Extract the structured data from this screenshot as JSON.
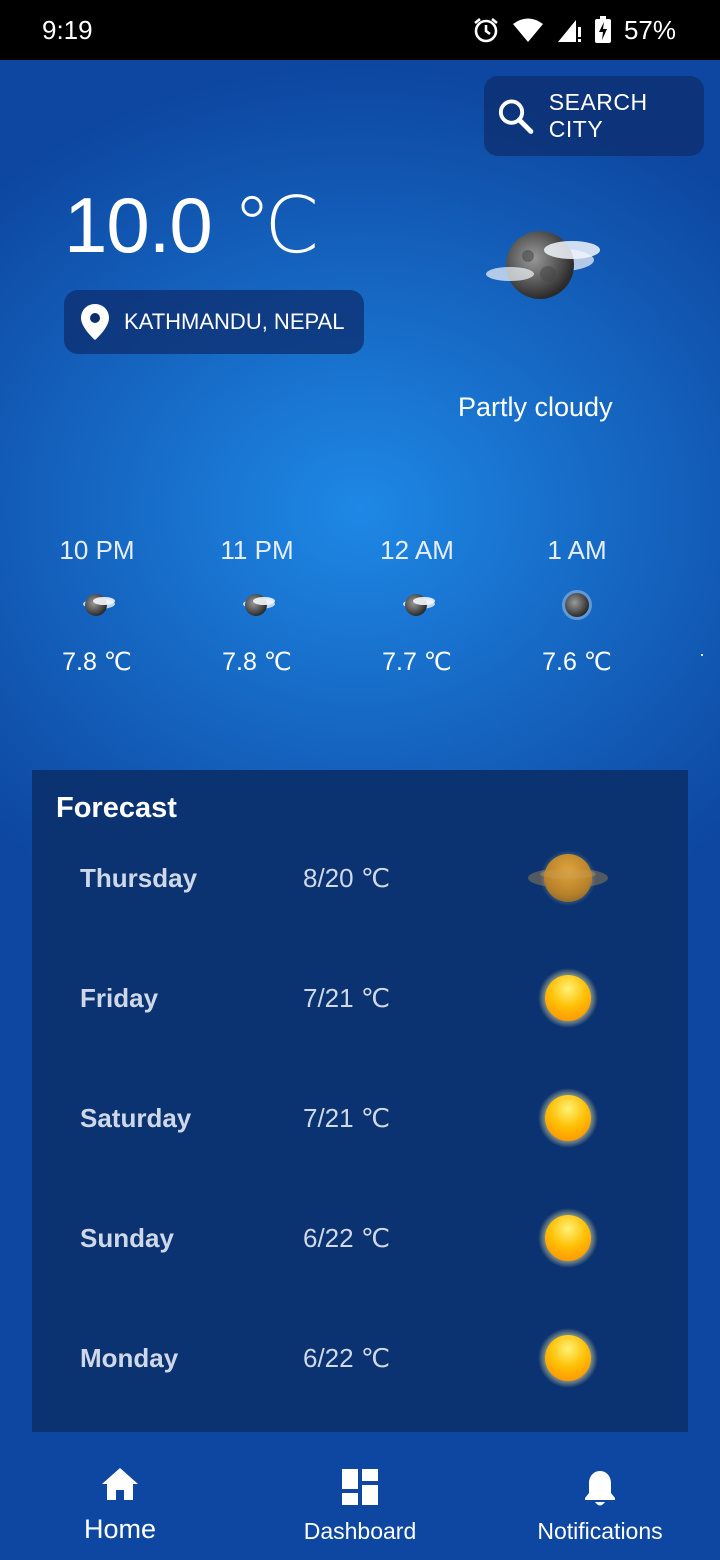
{
  "status_bar": {
    "time": "9:19",
    "battery": "57%",
    "icons": [
      "alarm-icon",
      "wifi-icon",
      "signal-icon",
      "battery-icon"
    ]
  },
  "search": {
    "label": "SEARCH CITY",
    "icon": "search-icon"
  },
  "current": {
    "temperature": "10.0 ℃",
    "location": "KATHMANDU, NEPAL",
    "condition": "Partly cloudy",
    "icon": "partly-cloudy-night-icon"
  },
  "hourly": [
    {
      "time": "10 PM",
      "temp": "7.8 ℃",
      "icon": "partly-cloudy-night-icon"
    },
    {
      "time": "11 PM",
      "temp": "7.8 ℃",
      "icon": "partly-cloudy-night-icon"
    },
    {
      "time": "12 AM",
      "temp": "7.7 ℃",
      "icon": "partly-cloudy-night-icon"
    },
    {
      "time": "1 AM",
      "temp": "7.6 ℃",
      "icon": "clear-night-icon"
    }
  ],
  "forecast": {
    "title": "Forecast",
    "days": [
      {
        "day": "Thursday",
        "temp": "8/20 ℃",
        "icon": "hazy-sun-icon"
      },
      {
        "day": "Friday",
        "temp": "7/21 ℃",
        "icon": "sun-icon"
      },
      {
        "day": "Saturday",
        "temp": "7/21 ℃",
        "icon": "sun-icon"
      },
      {
        "day": "Sunday",
        "temp": "6/22 ℃",
        "icon": "sun-icon"
      },
      {
        "day": "Monday",
        "temp": "6/22 ℃",
        "icon": "sun-icon"
      }
    ]
  },
  "nav": [
    {
      "label": "Home",
      "icon": "home-icon",
      "active": true
    },
    {
      "label": "Dashboard",
      "icon": "dashboard-icon",
      "active": false
    },
    {
      "label": "Notifications",
      "icon": "bell-icon",
      "active": false
    }
  ],
  "colors": {
    "background_center": "#1e88e5",
    "background_edge": "#0d47a1",
    "forecast_panel": "#0b3271",
    "chip": "#0d2d6e",
    "sun": "#ffb300"
  }
}
